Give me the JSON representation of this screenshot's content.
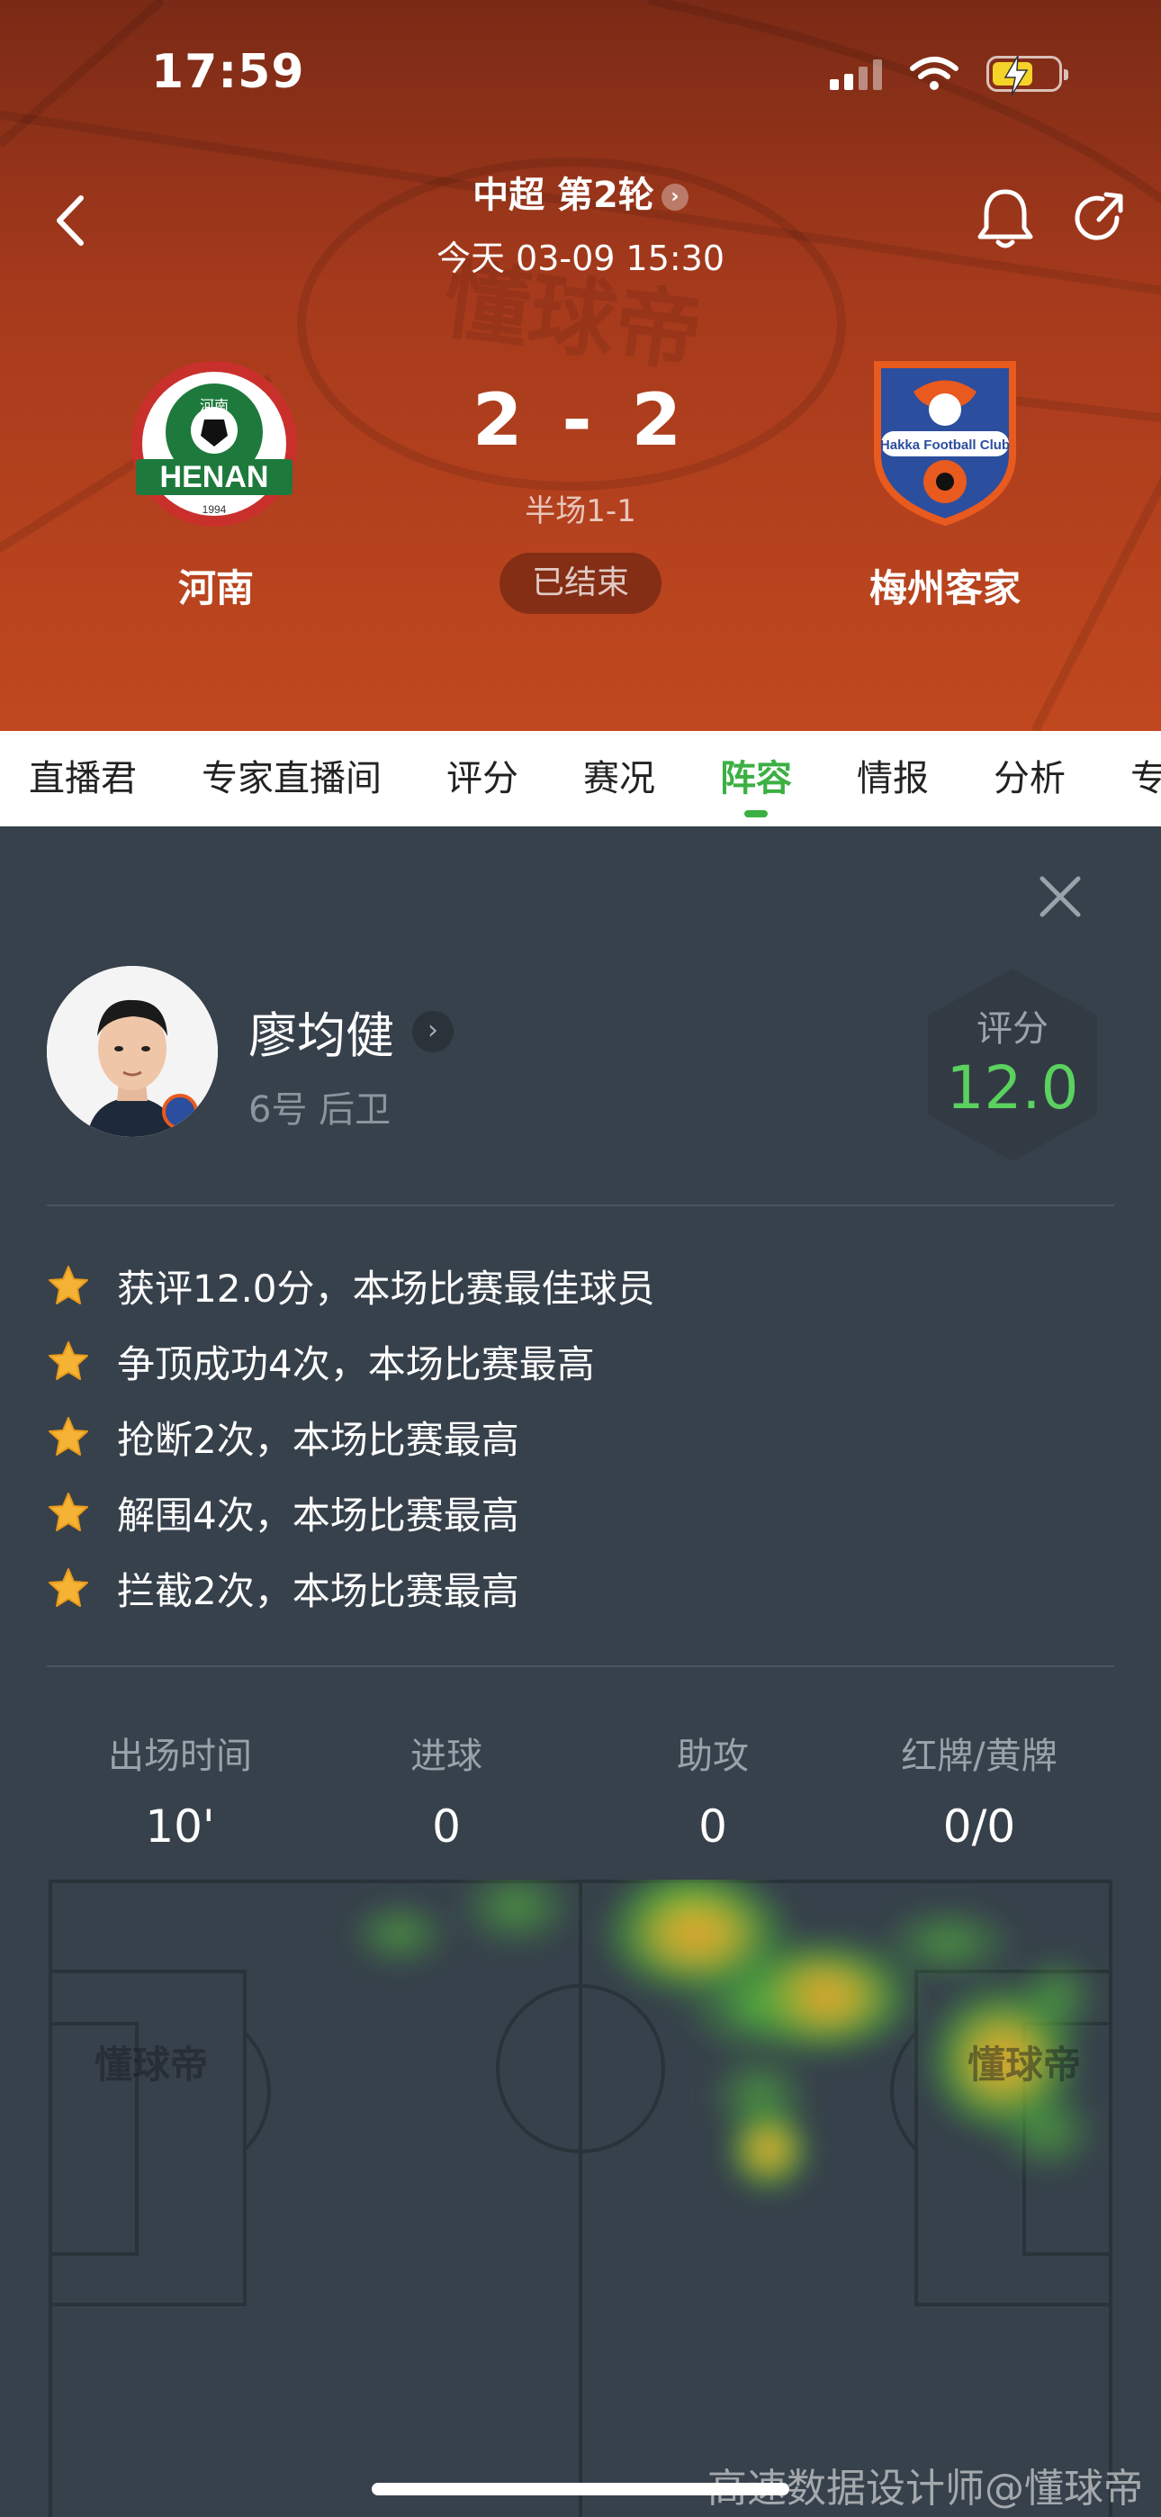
{
  "status_bar": {
    "time": "17:59"
  },
  "header": {
    "league_round": "中超 第2轮",
    "match_datetime": "今天 03-09 15:30",
    "home_team": "河南",
    "away_team": "梅州客家",
    "score": "2 - 2",
    "halftime": "半场1-1",
    "status": "已结束",
    "home_logo_text": "HENAN",
    "home_logo_sub": "河南",
    "home_logo_year": "1994",
    "away_logo_text": "Hakka Football Club"
  },
  "tabs": [
    {
      "label": "直播君"
    },
    {
      "label": "专家直播间"
    },
    {
      "label": "评分"
    },
    {
      "label": "赛况"
    },
    {
      "label": "阵容",
      "active": true
    },
    {
      "label": "情报"
    },
    {
      "label": "分析"
    },
    {
      "label": "专家"
    }
  ],
  "player": {
    "name": "廖均健",
    "number_position": "6号 后卫",
    "rating_label": "评分",
    "rating_value": "12.0"
  },
  "highlights": [
    "获评12.0分，本场比赛最佳球员",
    "争顶成功4次，本场比赛最高",
    "抢断2次，本场比赛最高",
    "解围4次，本场比赛最高",
    "拦截2次，本场比赛最高"
  ],
  "stats": [
    {
      "label": "出场时间",
      "value": "10'"
    },
    {
      "label": "进球",
      "value": "0"
    },
    {
      "label": "助攻",
      "value": "0"
    },
    {
      "label": "红牌/黄牌",
      "value": "0/0"
    }
  ],
  "pitch": {
    "logo_text_left": "懂球帝",
    "logo_text_right": "懂球帝"
  },
  "header_bg_text": "懂球帝",
  "watermark": "高速数据设计师@懂球帝",
  "colors": {
    "accent_green": "#3cb043",
    "rating_green": "#5bd15f",
    "header_orange": "#c1481f",
    "panel_bg": "#37414b"
  }
}
